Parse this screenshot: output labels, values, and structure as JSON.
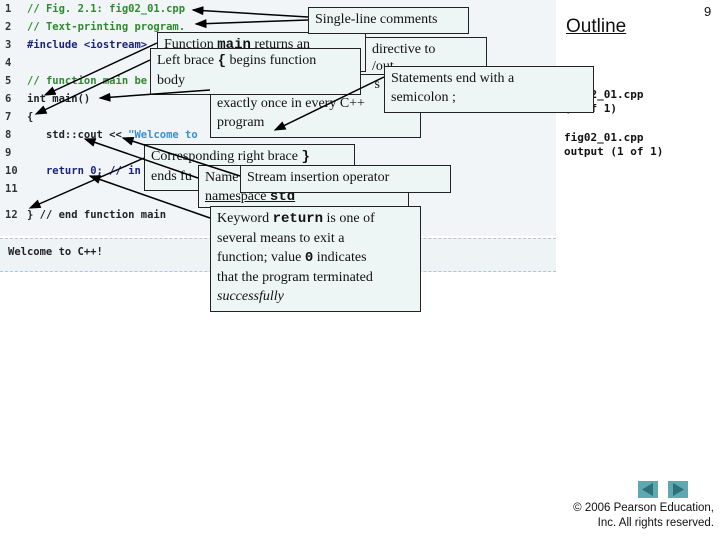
{
  "page_number": "9",
  "outline_title": "Outline",
  "side_labels": [
    {
      "line1": "fig02_01.cpp",
      "line2": "(1 of 1)"
    },
    {
      "line1": "fig02_01.cpp",
      "line2": "output (1 of 1)"
    }
  ],
  "code_lines": [
    {
      "num": "1",
      "text": "// Fig. 2.1: fig02_01.cpp",
      "kind": "comment"
    },
    {
      "num": "2",
      "text": "// Text-printing program.",
      "kind": "comment"
    },
    {
      "num": "3",
      "text": "#include <iostream>",
      "kind": "keyword"
    },
    {
      "num": "4",
      "text": "",
      "kind": "text"
    },
    {
      "num": "5",
      "text": "// function main be",
      "kind": "comment"
    },
    {
      "num": "6",
      "text": "int main()",
      "kind": "text"
    },
    {
      "num": "7",
      "text": "{",
      "kind": "text"
    },
    {
      "num": "8",
      "text": "   std::cout << ",
      "string": "\"Welcome to",
      "kind": "text"
    },
    {
      "num": "9",
      "text": "",
      "kind": "text"
    },
    {
      "num": "10",
      "text": "   return 0; // in",
      "kind": "keyword"
    },
    {
      "num": "11",
      "text": "",
      "kind": "text"
    },
    {
      "num": "12",
      "text": "} // end function main",
      "kind": "text"
    }
  ],
  "program_output": "Welcome to C++!",
  "callouts": {
    "comments": "Single-line comments",
    "preprocessor_1": "directive to",
    "preprocessor_2": "/out",
    "main_returns_pre": "Function ",
    "main_returns_code": "main",
    "main_returns_post": " returns an",
    "left_brace_pre": "Left brace ",
    "left_brace_code": "{",
    "left_brace_post": " begins function",
    "left_brace_2": "body",
    "main_once_0": "s",
    "main_once_1": "exactly once in every C++",
    "main_once_2": "program",
    "semicolon_1": "Statements end with a",
    "semicolon_2": "semicolon ;",
    "right_brace_pre": "Corresponding right brace ",
    "right_brace_code": "}",
    "right_brace_2": "ends fu",
    "namespace_1": "Name",
    "namespace_2_pre": "namespace ",
    "namespace_2_code": "std",
    "stream_insertion": "Stream insertion operator",
    "return_pre": "Keyword ",
    "return_code": "return",
    "return_post": " is one of",
    "return_2": "several means to exit a",
    "return_3_pre": "function; value ",
    "return_3_code": "0",
    "return_3_post": " indicates",
    "return_4": "that the program terminated",
    "return_5": "successfully"
  },
  "copyright_1": "© 2006 Pearson Education,",
  "copyright_2": "Inc.  All rights reserved.",
  "nav": {
    "prev_icon": "triangle-left-icon",
    "next_icon": "triangle-right-icon",
    "color": "#5fa8b0"
  }
}
